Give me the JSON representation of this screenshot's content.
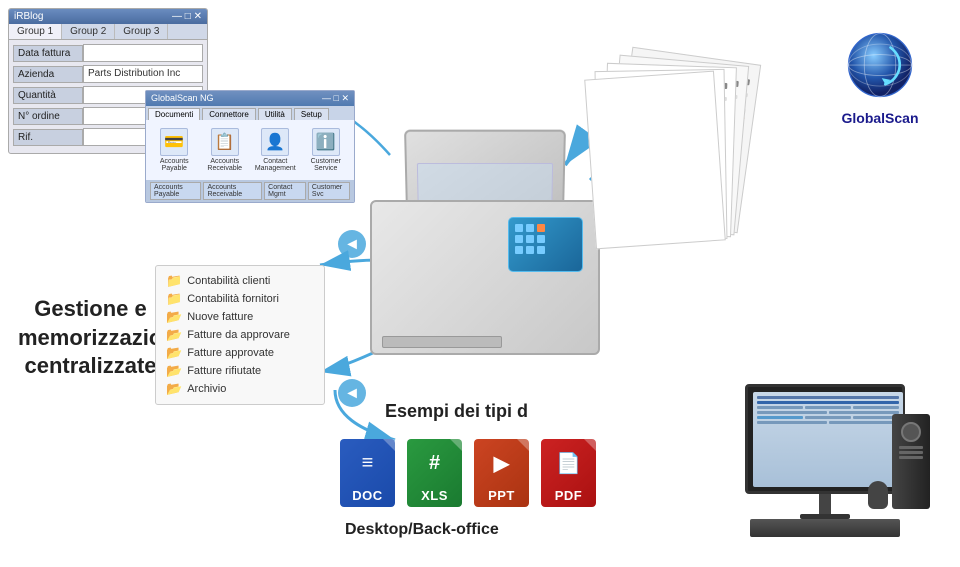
{
  "app": {
    "title": "iRBlog",
    "company_name": "Parts Distribution Inc"
  },
  "sw_window": {
    "title": "iRBlog",
    "tabs": [
      "Group 1",
      "Group 2",
      "Group 3"
    ],
    "fields": [
      {
        "label": "Data fattura",
        "value": ""
      },
      {
        "label": "Azienda",
        "value": "Parts Distribution Inc"
      },
      {
        "label": "Quantità",
        "value": ""
      },
      {
        "label": "N° ordine",
        "value": ""
      },
      {
        "label": "Rif.",
        "value": ""
      }
    ]
  },
  "inner_panel": {
    "title": "GlobalScan NG",
    "tabs": [
      "Documenti",
      "Connettore",
      "Utilità",
      "Setup"
    ],
    "icons": [
      {
        "label": "Accounts Payable",
        "symbol": "💳"
      },
      {
        "label": "Accounts Receivable",
        "symbol": "📋"
      },
      {
        "label": "Contact Management",
        "symbol": "👤"
      },
      {
        "label": "Customer Service",
        "symbol": "ℹ️"
      }
    ]
  },
  "folder_panel": {
    "items": [
      {
        "label": "Contabilità clienti",
        "type": "yellow"
      },
      {
        "label": "Contabilità fornitori",
        "type": "yellow"
      },
      {
        "label": "Nuove fatture",
        "type": "orange"
      },
      {
        "label": "Fatture da approvare",
        "type": "orange"
      },
      {
        "label": "Fatture approvate",
        "type": "orange"
      },
      {
        "label": "Fatture rifiutate",
        "type": "orange"
      },
      {
        "label": "Archivio",
        "type": "orange"
      }
    ]
  },
  "left_heading": {
    "line1": "Gestione  e",
    "line2": "memorizzazione",
    "line3": "centralizzate"
  },
  "file_types": {
    "heading": "Esempi dei tipi d",
    "items": [
      {
        "ext": "DOC",
        "type": "doc"
      },
      {
        "ext": "XLS",
        "type": "xls"
      },
      {
        "ext": "PPT",
        "type": "ppt"
      },
      {
        "ext": "PDF",
        "type": "pdf"
      }
    ],
    "footer": "Desktop/Back-office"
  },
  "globalscan": {
    "label": "GlobalScan"
  }
}
